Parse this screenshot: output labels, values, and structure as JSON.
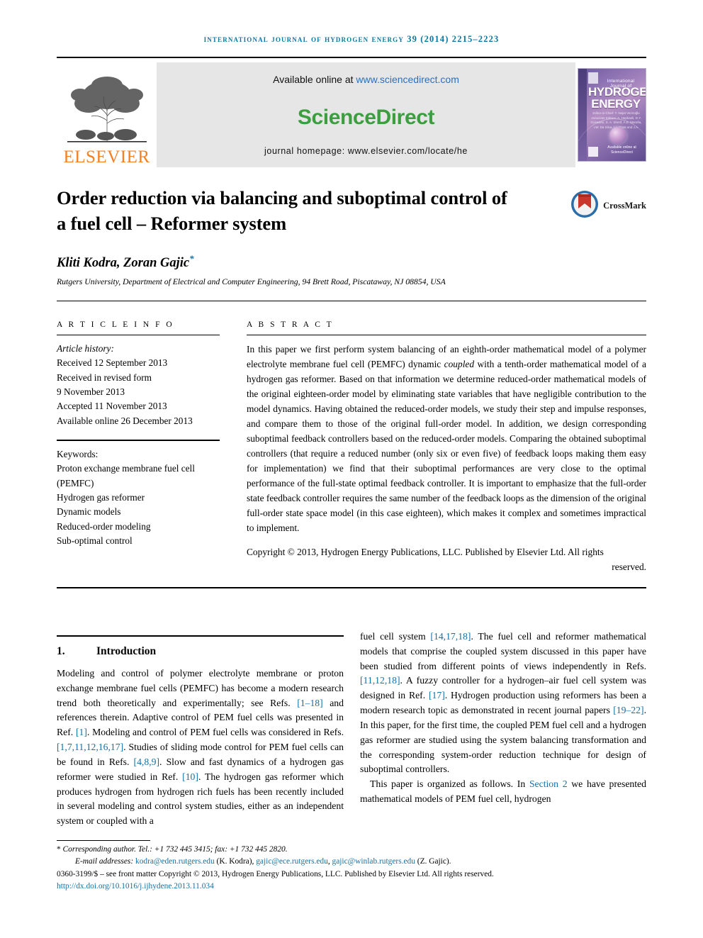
{
  "running_head": "International Journal of Hydrogen Energy 39 (2014) 2215–2223",
  "masthead": {
    "publisher": "ELSEVIER",
    "available_prefix": "Available online at ",
    "available_url": "www.sciencedirect.com",
    "sciencedirect_logo": "ScienceDirect",
    "homepage_line": "journal homepage: www.elsevier.com/locate/he",
    "cover": {
      "line_small": "International Journal of",
      "line_big1": "HYDROGEN",
      "line_big2": "ENERGY",
      "editors": "Editor-in-Chief: T. Nejat Veziroğlu    Associate Editors: A. Hepbasli, D.Y. Goswami, S. A. Sherif, A.E. Marafia, I.W. Da Silva, I.a. Frost and J.A. Turner",
      "footer": "Available online at ScienceDirect"
    }
  },
  "article": {
    "title": "Order reduction via balancing and suboptimal control of a fuel cell – Reformer system",
    "crossmark_label": "CrossMark",
    "authors": "Kliti Kodra, Zoran Gajic",
    "author_star": "*",
    "affiliation": "Rutgers University, Department of Electrical and Computer Engineering, 94 Brett Road, Piscataway, NJ 08854, USA"
  },
  "article_info": {
    "heading": "A R T I C L E   I N F O",
    "history_label": "Article history:",
    "history": [
      "Received 12 September 2013",
      "Received in revised form",
      "9 November 2013",
      "Accepted 11 November 2013",
      "Available online 26 December 2013"
    ],
    "keywords_label": "Keywords:",
    "keywords": [
      "Proton exchange membrane fuel cell",
      "(PEMFC)",
      "Hydrogen gas reformer",
      "Dynamic models",
      "Reduced-order modeling",
      "Sub-optimal control"
    ]
  },
  "abstract": {
    "heading": "A B S T R A C T",
    "part1": "In this paper we first perform system balancing of an eighth-order mathematical model of a polymer electrolyte membrane fuel cell (PEMFC) dynamic ",
    "italic_word": "coupled",
    "part2": " with a tenth-order mathematical model of a hydrogen gas reformer. Based on that information we determine reduced-order mathematical models of the original eighteen-order model by eliminating state variables that have negligible contribution to the model dynamics. Having obtained the reduced-order models, we study their step and impulse responses, and compare them to those of the original full-order model. In addition, we design corresponding suboptimal feedback controllers based on the reduced-order models. Comparing the obtained suboptimal controllers (that require a reduced number (only six or even five) of feedback loops making them easy for implementation) we find that their suboptimal performances are very close to the optimal performance of the full-state optimal feedback controller. It is important to emphasize that the full-order state feedback controller requires the same number of the feedback loops as the dimension of the original full-order state space model (in this case eighteen), which makes it complex and sometimes impractical to implement.",
    "copyright": "Copyright © 2013, Hydrogen Energy Publications, LLC. Published by Elsevier Ltd. All rights",
    "copyright_last": "reserved."
  },
  "introduction": {
    "number": "1.",
    "title": "Introduction",
    "left_p1_a": "Modeling and control of polymer electrolyte membrane or proton exchange membrane fuel cells (PEMFC) has become a modern research trend both theoretically and experimentally; see Refs. ",
    "ref_1_18": "[1–18]",
    "left_p1_b": " and references therein. Adaptive control of PEM fuel cells was presented in Ref. ",
    "ref_1": "[1]",
    "left_p1_c": ". Modeling and control of PEM fuel cells was considered in Refs. ",
    "ref_multi": "[1,7,11,12,16,17]",
    "left_p1_d": ". Studies of sliding mode control for PEM fuel cells can be found in Refs. ",
    "ref_489": "[4,8,9]",
    "left_p1_e": ". Slow and fast dynamics of a hydrogen gas reformer were studied in Ref. ",
    "ref_10": "[10]",
    "left_p1_f": ". The hydrogen gas reformer which produces hydrogen from hydrogen rich fuels has been recently included in several modeling and control system studies, either as an independent system or coupled with a ",
    "right_p1_a": "fuel cell system ",
    "ref_141718": "[14,17,18]",
    "right_p1_b": ". The fuel cell and reformer mathematical models that comprise the coupled system discussed in this paper have been studied from different points of views independently in Refs. ",
    "ref_111218": "[11,12,18]",
    "right_p1_c": ". A fuzzy controller for a hydrogen–air fuel cell system was designed in Ref. ",
    "ref_17": "[17]",
    "right_p1_d": ". Hydrogen production using reformers has been a modern research topic as demonstrated in recent journal papers ",
    "ref_1922": "[19–22]",
    "right_p1_e": ". In this paper, for the first time, the coupled PEM fuel cell and a hydrogen gas reformer are studied using the system balancing transformation and the corresponding system-order reduction technique for design of suboptimal controllers.",
    "right_p2_a": "This paper is organized as follows. In ",
    "ref_section2": "Section 2",
    "right_p2_b": " we have presented mathematical models of PEM fuel cell, hydrogen"
  },
  "footnote": {
    "star": "*",
    "corresponding": " Corresponding author. Tel.: +1 732 445 3415; fax: +1 732 445 2820.",
    "email_label": "E-mail addresses: ",
    "email1": "kodra@eden.rutgers.edu",
    "email1_name": " (K. Kodra), ",
    "email2": "gajic@ece.rutgers.edu",
    "email_sep": ", ",
    "email3": "gajic@winlab.rutgers.edu",
    "email3_name": " (Z. Gajic).",
    "issn_line": "0360-3199/$ – see front matter Copyright © 2013, Hydrogen Energy Publications, LLC. Published by Elsevier Ltd. All rights reserved.",
    "doi": "http://dx.doi.org/10.1016/j.ijhydene.2013.11.034"
  },
  "colors": {
    "link_blue": "#1471a5",
    "running_head_blue": "#0b76a0",
    "sciencedirect_green": "#3b9e3f",
    "elsevier_orange": "#f48024",
    "sd_url_blue": "#2f6fb5"
  }
}
